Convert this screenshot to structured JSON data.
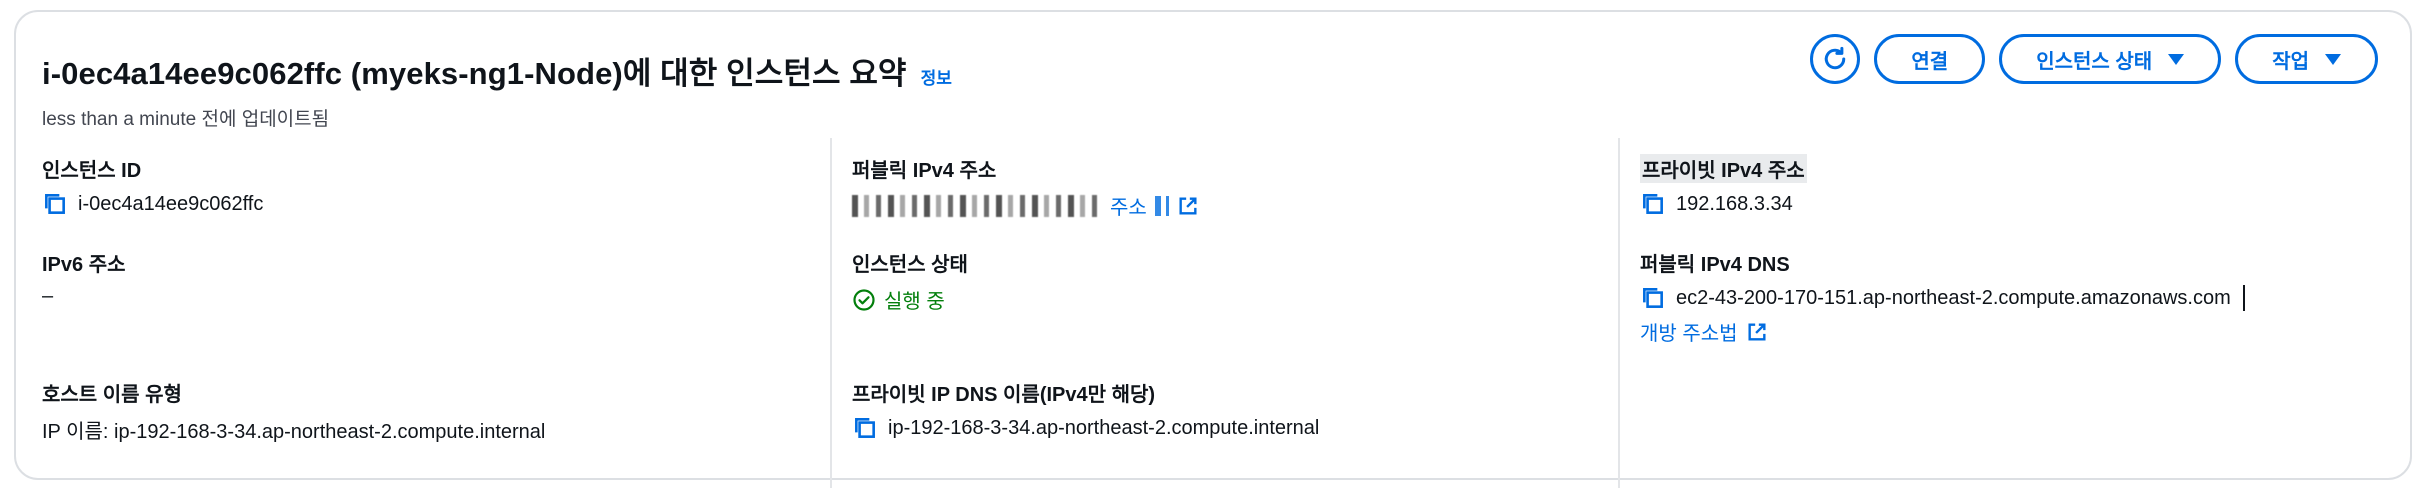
{
  "header": {
    "title": "i-0ec4a14ee9c062ffc (myeks-ng1-Node)에 대한 인스턴스 요약",
    "info_link": "정보",
    "subtitle": "less than a minute 전에 업데이트됨",
    "refresh_icon": "refresh-icon",
    "connect_label": "연결",
    "instance_state_label": "인스턴스 상태",
    "actions_label": "작업"
  },
  "col1": {
    "instance_id_label": "인스턴스 ID",
    "instance_id_value": "i-0ec4a14ee9c062ffc",
    "ipv6_label": "IPv6 주소",
    "ipv6_value": "–",
    "hostname_type_label": "호스트 이름 유형",
    "hostname_type_value": "IP 이름: ip-192-168-3-34.ap-northeast-2.compute.internal"
  },
  "col2": {
    "public_ipv4_label": "퍼블릭 IPv4 주소",
    "public_ipv4_link": "주소",
    "state_label": "인스턴스 상태",
    "state_value": "실행 중",
    "private_dns_label": "프라이빗 IP DNS 이름(IPv4만 해당)",
    "private_dns_value": "ip-192-168-3-34.ap-northeast-2.compute.internal"
  },
  "col3": {
    "private_ipv4_label": "프라이빗 IPv4 주소",
    "private_ipv4_value": "192.168.3.34",
    "public_dns_label": "퍼블릭 IPv4 DNS",
    "public_dns_value": "ec2-43-200-170-151.ap-northeast-2.compute.amazonaws.com",
    "open_address_link": "개방 주소법"
  },
  "colors": {
    "accent": "#006ce0",
    "success": "#037f0c",
    "text": "#0f141a"
  }
}
